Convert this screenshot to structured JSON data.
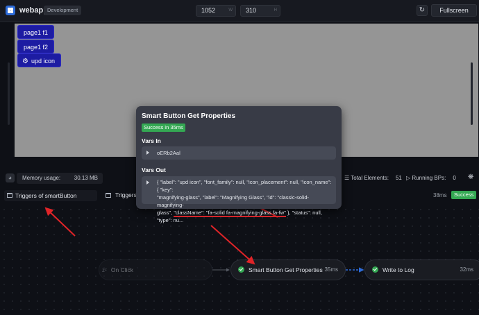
{
  "header": {
    "app_title": "webapp",
    "env_badge": "Development",
    "width_value": "1052",
    "width_unit": "W",
    "height_value": "310",
    "height_unit": "H",
    "fullscreen_label": "Fullscreen"
  },
  "preview": {
    "buttons": [
      {
        "label": "page1 f1"
      },
      {
        "label": "page1 f2"
      },
      {
        "label": "upd icon",
        "icon": "gear-icon"
      }
    ]
  },
  "statusbar": {
    "memory_label": "Memory usage:",
    "memory_value": "30.13 MB",
    "total_label": "Total Elements:",
    "total_value": "51",
    "running_label": "Running BPs:",
    "running_value": "0"
  },
  "triggers": {
    "left_label": "Triggers of smartButton",
    "right_label": "Triggers",
    "right_time": "38ms",
    "right_status": "Success"
  },
  "flow": {
    "nodes": [
      {
        "label": "On Click",
        "time": ""
      },
      {
        "label": "Smart Button Get Properties",
        "time": "35ms"
      },
      {
        "label": "Write to Log",
        "time": "32ms"
      }
    ]
  },
  "popover": {
    "title": "Smart Button Get Properties",
    "badge": "Success in 35ms",
    "vars_in_label": "Vars In",
    "vars_in_value": "oERb2Aal",
    "vars_out_label": "Vars Out",
    "vars_out_line1": "{ \"label\": \"upd icon\", \"font_family\": null, \"icon_placement\": null, \"icon_name\": { \"key\":",
    "vars_out_line2": "\"magnifying-glass\", \"label\": \"Magnifying Glass\", \"id\": \"classic-solid-magnifying-",
    "vars_out_line3a": "glass\", ",
    "vars_out_line3b": "\"className\": \"fa-solid fa-magnifying-glass fa-fw\"",
    "vars_out_line3c": " }, \"status\": null, \"type\": nu..."
  },
  "colors": {
    "accent": "#2d6bd8",
    "success": "#34a853",
    "preview_button": "#1d1ca2",
    "annotation": "#d6252a"
  }
}
